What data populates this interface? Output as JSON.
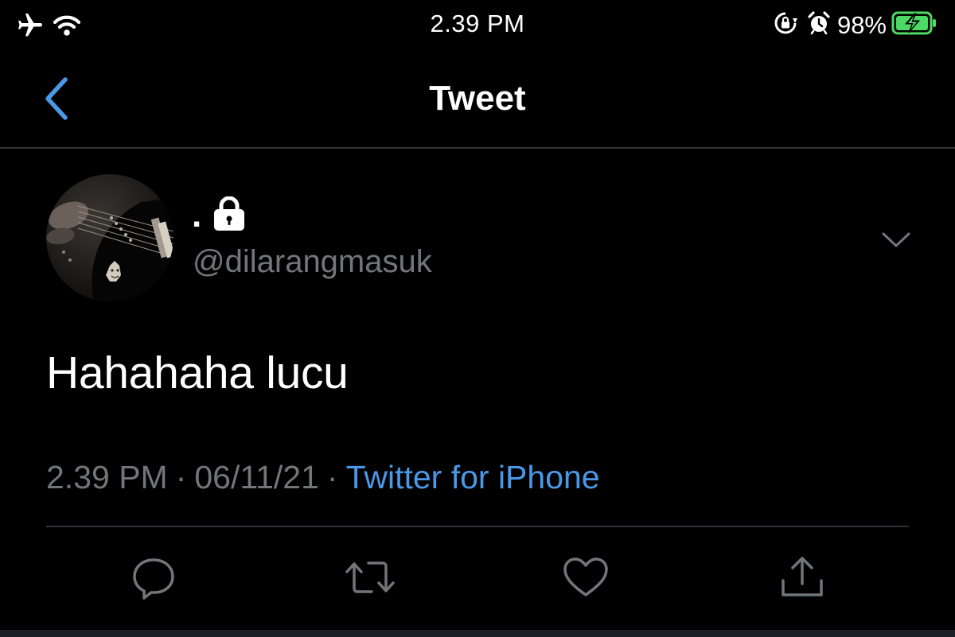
{
  "status_bar": {
    "time": "2.39 PM",
    "battery_percent": "98%",
    "icons": [
      "airplane-icon",
      "wifi-icon",
      "orientation-lock-icon",
      "alarm-icon",
      "battery-charging-icon"
    ]
  },
  "nav": {
    "title": "Tweet",
    "back_icon": "chevron-left-icon"
  },
  "tweet": {
    "display_name": ".",
    "protected_icon": "lock-icon",
    "handle": "@dilarangmasuk",
    "text": "Hahahaha lucu",
    "time": "2.39 PM",
    "separator": "·",
    "date": "06/11/21",
    "source": "Twitter for iPhone",
    "more_icon": "chevron-down-icon"
  },
  "actions": [
    {
      "name": "reply",
      "icon": "reply-icon"
    },
    {
      "name": "retweet",
      "icon": "retweet-icon"
    },
    {
      "name": "like",
      "icon": "heart-icon"
    },
    {
      "name": "share",
      "icon": "share-icon"
    }
  ],
  "colors": {
    "background": "#000000",
    "accent": "#4a99e9",
    "secondary_text": "#71767b",
    "divider": "#2f3336",
    "battery": "#4cd964"
  }
}
